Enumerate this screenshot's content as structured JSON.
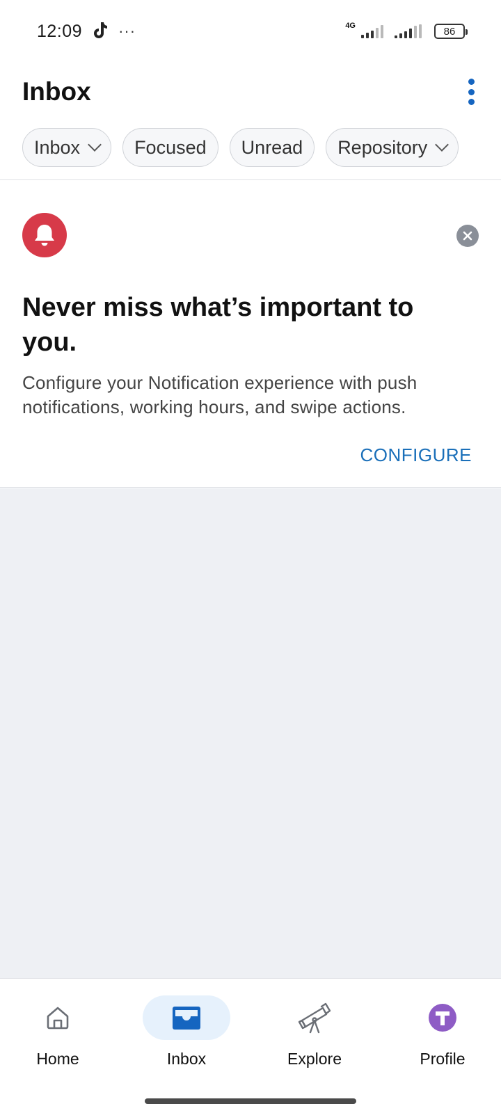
{
  "status_bar": {
    "time": "12:09",
    "network": "4G",
    "battery": "86"
  },
  "header": {
    "title": "Inbox"
  },
  "filters": [
    {
      "label": "Inbox",
      "has_dropdown": true
    },
    {
      "label": "Focused",
      "has_dropdown": false
    },
    {
      "label": "Unread",
      "has_dropdown": false
    },
    {
      "label": "Repository",
      "has_dropdown": true
    }
  ],
  "banner": {
    "title": "Never miss what’s important to you.",
    "description": "Configure your Notification experience with push notifications, working hours, and swipe actions.",
    "action_label": "CONFIGURE",
    "icon": "bell-icon",
    "icon_bg": "#d73a49"
  },
  "bottom_nav": {
    "items": [
      {
        "label": "Home",
        "icon": "home-icon",
        "active": false
      },
      {
        "label": "Inbox",
        "icon": "inbox-icon",
        "active": true
      },
      {
        "label": "Explore",
        "icon": "telescope-icon",
        "active": false
      },
      {
        "label": "Profile",
        "icon": "avatar-icon",
        "active": false
      }
    ]
  },
  "colors": {
    "accent": "#1565c0",
    "link": "#1a6fb9",
    "empty_bg": "#eef0f4",
    "profile_avatar": "#8e5cc5"
  }
}
